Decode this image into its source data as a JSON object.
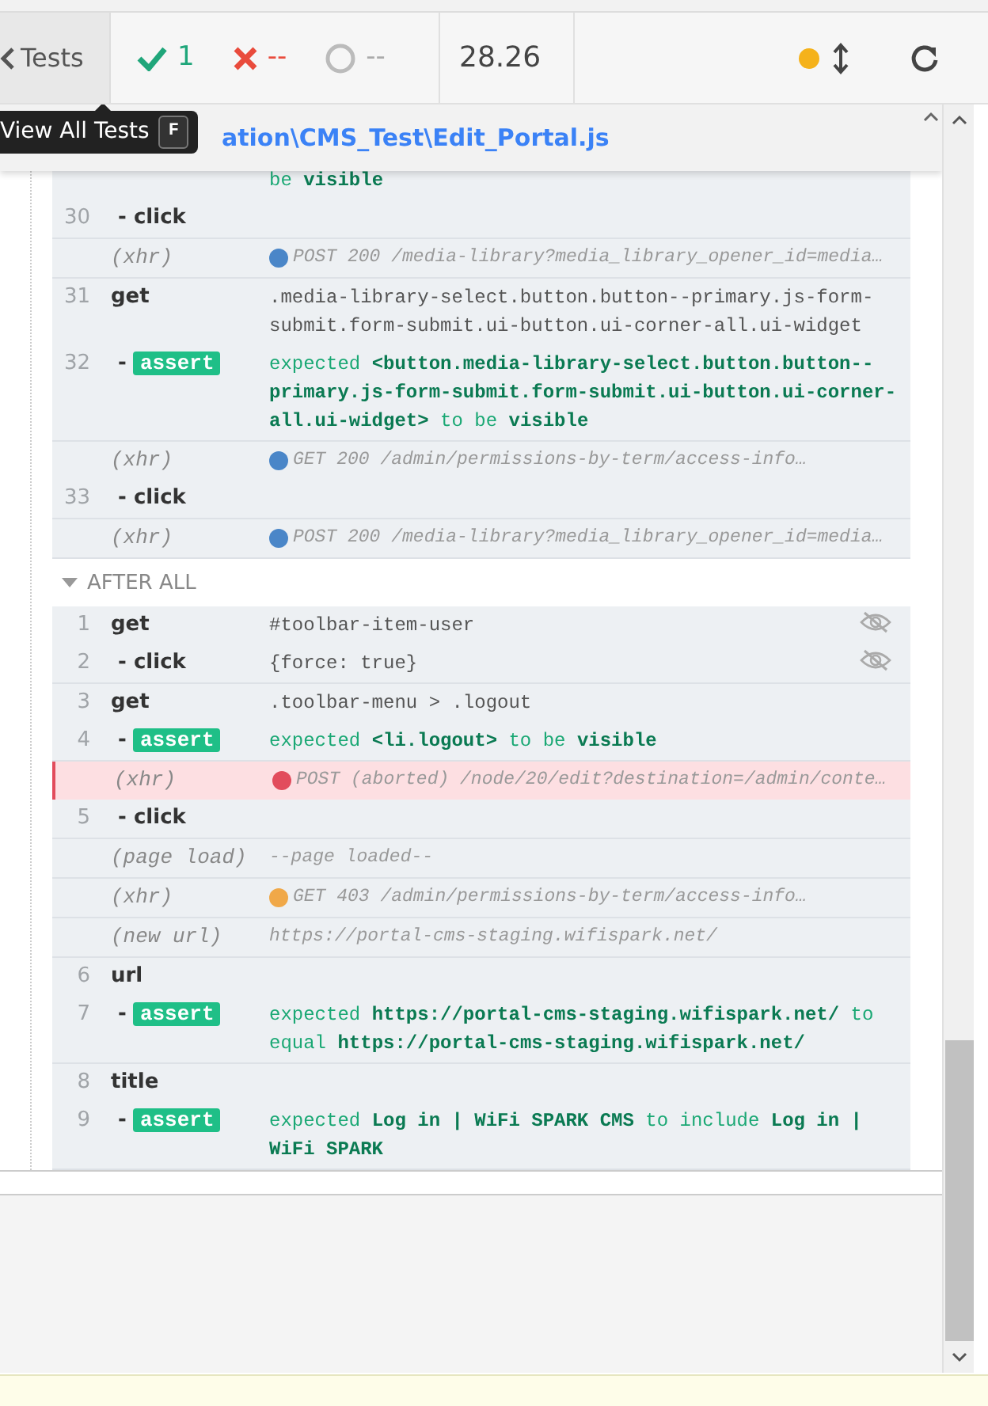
{
  "header": {
    "back_button": "Tests",
    "passed": "1",
    "failed": "--",
    "pending": "--",
    "duration": "28.26",
    "tooltip": {
      "label": "View All Tests",
      "shortcut": "F"
    }
  },
  "spec_path": "ation\\CMS_Test\\Edit_Portal.js",
  "sections": [
    {
      "groups": [
        [
          {
            "kind": "continuation",
            "message": "be **visible**"
          },
          {
            "kind": "child",
            "number": "30",
            "prefix": "-",
            "name": "click"
          }
        ],
        [
          {
            "kind": "event",
            "name": "(xhr)",
            "color": "#4a86c8",
            "failed": false,
            "message": "POST 200 /media-library?media_library_opener_id=media…"
          }
        ],
        [
          {
            "kind": "command",
            "number": "31",
            "name": "get",
            "message": ".media-library-select.button.button--primary.js-form-submit.form-submit.ui-button.ui-corner-all.ui-widget"
          },
          {
            "kind": "assert",
            "number": "32",
            "prefix": "-",
            "name": "assert",
            "message": "expected **<button.media-library-select.button.button--primary.js-form-submit.form-submit.ui-button.ui-corner-all.ui-widget>** to be **visible**"
          }
        ],
        [
          {
            "kind": "event",
            "name": "(xhr)",
            "color": "#4a86c8",
            "failed": false,
            "message": "GET 200 /admin/permissions-by-term/access-info…"
          },
          {
            "kind": "child",
            "number": "33",
            "prefix": "-",
            "name": "click"
          }
        ],
        [
          {
            "kind": "event",
            "name": "(xhr)",
            "color": "#4a86c8",
            "failed": false,
            "message": "POST 200 /media-library?media_library_opener_id=media…"
          }
        ]
      ]
    },
    {
      "title": "AFTER ALL",
      "groups": [
        [
          {
            "kind": "command",
            "number": "1",
            "name": "get",
            "message": "#toolbar-item-user",
            "hidden": true
          },
          {
            "kind": "child",
            "number": "2",
            "prefix": "-",
            "name": "click",
            "message": "{force: true}",
            "hidden": true
          }
        ],
        [
          {
            "kind": "command",
            "number": "3",
            "name": "get",
            "message": ".toolbar-menu > .logout"
          },
          {
            "kind": "assert",
            "number": "4",
            "prefix": "-",
            "name": "assert",
            "message": "expected **<li.logout>** to be **visible**"
          }
        ],
        [
          {
            "kind": "event",
            "name": "(xhr)",
            "color": "#e24c5c",
            "failed": true,
            "message": "POST (aborted) /node/20/edit?destination=/admin/conte…"
          },
          {
            "kind": "child",
            "number": "5",
            "prefix": "-",
            "name": "click"
          }
        ],
        [
          {
            "kind": "event",
            "name": "(page load)",
            "failed": false,
            "message": "--page loaded--"
          }
        ],
        [
          {
            "kind": "event",
            "name": "(xhr)",
            "color": "#f0a848",
            "failed": false,
            "message": "GET 403 /admin/permissions-by-term/access-info…"
          }
        ],
        [
          {
            "kind": "event",
            "name": "(new url)",
            "failed": false,
            "message": "https://portal-cms-staging.wifispark.net/"
          }
        ],
        [
          {
            "kind": "command",
            "number": "6",
            "name": "url"
          },
          {
            "kind": "assert",
            "number": "7",
            "prefix": "-",
            "name": "assert",
            "message": "expected **https://portal-cms-staging.wifispark.net/** to equal **https://portal-cms-staging.wifispark.net/**"
          }
        ],
        [
          {
            "kind": "command",
            "number": "8",
            "name": "title"
          },
          {
            "kind": "assert",
            "number": "9",
            "prefix": "-",
            "name": "assert",
            "message": "expected **Log in | WiFi SPARK CMS** to include **Log in | WiFi SPARK**"
          }
        ]
      ]
    }
  ]
}
